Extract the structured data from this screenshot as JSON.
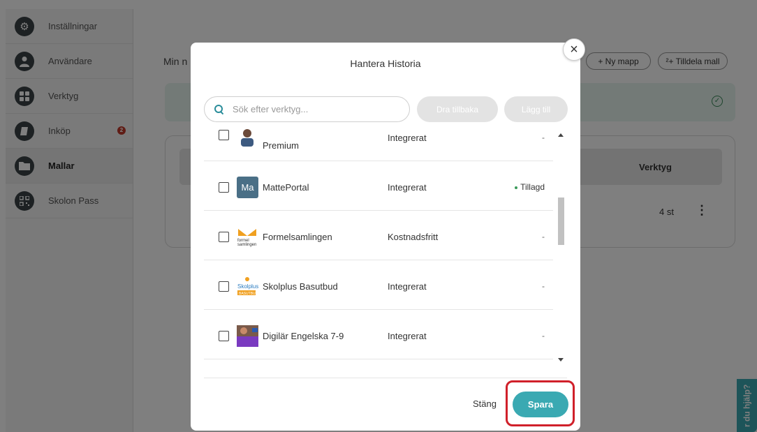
{
  "sidebar": {
    "items": [
      {
        "label": "Inställningar",
        "icon": "gear-icon"
      },
      {
        "label": "Användare",
        "icon": "user-icon"
      },
      {
        "label": "Verktyg",
        "icon": "grid-icon"
      },
      {
        "label": "Inköp",
        "icon": "book-icon",
        "badge": "2"
      },
      {
        "label": "Mallar",
        "icon": "folder-icon",
        "active": true
      },
      {
        "label": "Skolon Pass",
        "icon": "qr-icon"
      }
    ]
  },
  "main": {
    "title_partial": "Min n",
    "new_folder": "+ Ny mapp",
    "assign_template": "²+ Tilldela mall",
    "column_tools": "Verktyg",
    "row_tool_count": "4 st",
    "help_tab": "r du hjälp?"
  },
  "modal": {
    "title": "Hantera Historia",
    "search_placeholder": "Sök efter verktyg...",
    "btn_pull_back": "Dra tillbaka",
    "btn_add": "Lägg till",
    "rows": [
      {
        "name": "Premium",
        "type": "Integrerat",
        "status": "-"
      },
      {
        "name": "MattePortal",
        "logo_text": "Ma",
        "type": "Integrerat",
        "status": "Tillagd"
      },
      {
        "name": "Formelsamlingen",
        "logo_text": "formel samlingen",
        "type": "Kostnadsfritt",
        "status": "-"
      },
      {
        "name": "Skolplus Basutbud",
        "logo_text": "Skolplus BASUTBUD",
        "type": "Integrerat",
        "status": "-"
      },
      {
        "name": "Digilär Engelska 7-9",
        "type": "Integrerat",
        "status": "-"
      }
    ],
    "close_label": "Stäng",
    "save_label": "Spara"
  },
  "colors": {
    "accent": "#3aa9b2",
    "highlight": "#d0202a"
  }
}
